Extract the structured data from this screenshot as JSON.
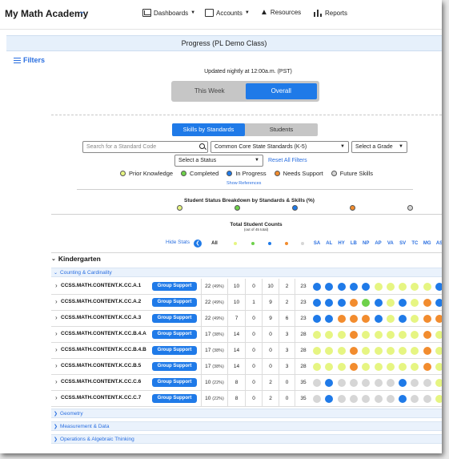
{
  "brand": {
    "name": "My Math Academy"
  },
  "nav": [
    {
      "label": "Dashboards",
      "icon": "chart-icon"
    },
    {
      "label": "Accounts",
      "icon": "accounts-icon"
    },
    {
      "label": "Resources",
      "icon": "resources-icon"
    },
    {
      "label": "Reports",
      "icon": "reports-icon"
    }
  ],
  "page": {
    "title": "Progress (PL Demo Class)",
    "filters_label": "Filters",
    "updated_text": "Updated nightly at 12:00a.m. (PST)",
    "period_options": [
      "This Week",
      "Overall"
    ],
    "period_selected": "Overall",
    "view_options": [
      "Skills by Standards",
      "Students"
    ],
    "view_selected": "Skills by Standards",
    "search_placeholder": "Search for a Standard Code",
    "standard_select": "Common Core State Standards (K-5)",
    "grade_select": "Select a Grade",
    "status_select": "Select a Status",
    "reset_label": "Reset All Filters",
    "show_references": "Show References",
    "breakdown_title": "Student Status Breakdown by Standards & Skills (%)",
    "counts_title": "Total Student Counts",
    "counts_sub": "(out of 45 total)",
    "hide_stats": "Hide Stats",
    "all_label": "All"
  },
  "legend": [
    {
      "label": "Prior Knowledge",
      "color": "#e6f582"
    },
    {
      "label": "Completed",
      "color": "#6ed14a"
    },
    {
      "label": "In Progress",
      "color": "#1f7ae8"
    },
    {
      "label": "Needs Support",
      "color": "#f28c2e"
    },
    {
      "label": "Future Skills",
      "color": "#d6d6d6"
    }
  ],
  "students": [
    "SA",
    "AL",
    "HY",
    "LB",
    "NP",
    "AP",
    "VA",
    "SV",
    "TC",
    "MG",
    "AS"
  ],
  "grade": "Kindergarten",
  "groups": [
    "Counting & Cardinality",
    "Geometry",
    "Measurement & Data",
    "Operations & Algebraic Thinking"
  ],
  "group_support_label": "Group Support",
  "rows": [
    {
      "code": "CCSS.MATH.CONTENT.K.CC.A.1",
      "count": "22",
      "pct": "(49%)",
      "pk": "10",
      "c": "0",
      "ip": "10",
      "ns": "2",
      "fs": "23",
      "dots": [
        "B",
        "B",
        "B",
        "B",
        "B",
        "Y",
        "Y",
        "Y",
        "Y",
        "Y",
        "B"
      ]
    },
    {
      "code": "CCSS.MATH.CONTENT.K.CC.A.2",
      "count": "22",
      "pct": "(49%)",
      "pk": "10",
      "c": "1",
      "ip": "9",
      "ns": "2",
      "fs": "23",
      "dots": [
        "B",
        "B",
        "B",
        "O",
        "G",
        "B",
        "Y",
        "B",
        "Y",
        "O",
        "B"
      ]
    },
    {
      "code": "CCSS.MATH.CONTENT.K.CC.A.3",
      "count": "22",
      "pct": "(49%)",
      "pk": "7",
      "c": "0",
      "ip": "9",
      "ns": "6",
      "fs": "23",
      "dots": [
        "B",
        "B",
        "O",
        "O",
        "O",
        "B",
        "Y",
        "B",
        "Y",
        "O",
        "O"
      ]
    },
    {
      "code": "CCSS.MATH.CONTENT.K.CC.B.4.A",
      "count": "17",
      "pct": "(38%)",
      "pk": "14",
      "c": "0",
      "ip": "0",
      "ns": "3",
      "fs": "28",
      "dots": [
        "Y",
        "Y",
        "Y",
        "O",
        "Y",
        "Y",
        "Y",
        "Y",
        "Y",
        "O",
        "Y"
      ]
    },
    {
      "code": "CCSS.MATH.CONTENT.K.CC.B.4.B",
      "count": "17",
      "pct": "(38%)",
      "pk": "14",
      "c": "0",
      "ip": "0",
      "ns": "3",
      "fs": "28",
      "dots": [
        "Y",
        "Y",
        "Y",
        "O",
        "Y",
        "Y",
        "Y",
        "Y",
        "Y",
        "O",
        "Y"
      ]
    },
    {
      "code": "CCSS.MATH.CONTENT.K.CC.B.5",
      "count": "17",
      "pct": "(38%)",
      "pk": "14",
      "c": "0",
      "ip": "0",
      "ns": "3",
      "fs": "28",
      "dots": [
        "Y",
        "Y",
        "Y",
        "O",
        "Y",
        "Y",
        "Y",
        "Y",
        "Y",
        "O",
        "Y"
      ]
    },
    {
      "code": "CCSS.MATH.CONTENT.K.CC.C.6",
      "count": "10",
      "pct": "(22%)",
      "pk": "8",
      "c": "0",
      "ip": "2",
      "ns": "0",
      "fs": "35",
      "dots": [
        "X",
        "B",
        "X",
        "X",
        "X",
        "X",
        "X",
        "B",
        "X",
        "X",
        "Y"
      ]
    },
    {
      "code": "CCSS.MATH.CONTENT.K.CC.C.7",
      "count": "10",
      "pct": "(22%)",
      "pk": "8",
      "c": "0",
      "ip": "2",
      "ns": "0",
      "fs": "35",
      "dots": [
        "X",
        "B",
        "X",
        "X",
        "X",
        "X",
        "X",
        "B",
        "X",
        "X",
        "Y"
      ]
    }
  ],
  "colors": {
    "Y": "#e6f582",
    "G": "#6ed14a",
    "B": "#1f7ae8",
    "O": "#f28c2e",
    "X": "#d6d6d6",
    "accent": "#1f7ae8"
  }
}
